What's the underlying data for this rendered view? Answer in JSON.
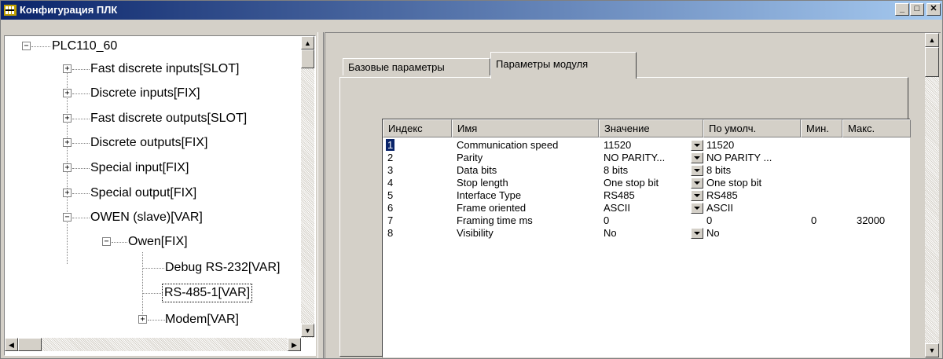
{
  "window": {
    "title": "Конфигурация ПЛК",
    "minimize_label": "_",
    "maximize_label": "□",
    "close_label": "✕"
  },
  "tree": {
    "root": "PLC110_60",
    "items": [
      {
        "label": "Fast discrete inputs[SLOT]"
      },
      {
        "label": "Discrete inputs[FIX]"
      },
      {
        "label": "Fast discrete outputs[SLOT]"
      },
      {
        "label": "Discrete outputs[FIX]"
      },
      {
        "label": "Special input[FIX]"
      },
      {
        "label": "Special output[FIX]"
      },
      {
        "label": "OWEN (slave)[VAR]"
      },
      {
        "label": "Owen[FIX]"
      },
      {
        "label": "Debug RS-232[VAR]"
      },
      {
        "label": "RS-485-1[VAR]"
      },
      {
        "label": "Modem[VAR]"
      }
    ],
    "selected": "RS-485-1[VAR]"
  },
  "tabs": [
    {
      "label": "Базовые параметры"
    },
    {
      "label": "Параметры модуля"
    }
  ],
  "active_tab": "Параметры модуля",
  "table": {
    "columns": [
      "Индекс",
      "Имя",
      "Значение",
      "По умолч.",
      "Мин.",
      "Макс."
    ],
    "rows": [
      {
        "index": "1",
        "name": "Communication speed",
        "value": "11520",
        "default": "11520",
        "min": "",
        "max": ""
      },
      {
        "index": "2",
        "name": "Parity",
        "value": "NO PARITY...",
        "default": "NO PARITY ...",
        "min": "",
        "max": ""
      },
      {
        "index": "3",
        "name": "Data bits",
        "value": "8 bits",
        "default": "8 bits",
        "min": "",
        "max": ""
      },
      {
        "index": "4",
        "name": "Stop length",
        "value": "One stop bit",
        "default": "One stop bit",
        "min": "",
        "max": ""
      },
      {
        "index": "5",
        "name": "Interface Type",
        "value": "RS485",
        "default": "RS485",
        "min": "",
        "max": ""
      },
      {
        "index": "6",
        "name": "Frame oriented",
        "value": "ASCII",
        "default": "ASCII",
        "min": "",
        "max": ""
      },
      {
        "index": "7",
        "name": "Framing time ms",
        "value": "0",
        "default": "0",
        "min": "0",
        "max": "32000"
      },
      {
        "index": "8",
        "name": "Visibility",
        "value": "No",
        "default": "No",
        "min": "",
        "max": ""
      }
    ]
  },
  "colors": {
    "titlebar": "#0a246a",
    "face": "#d4d0c8",
    "selection": "#0a246a"
  }
}
